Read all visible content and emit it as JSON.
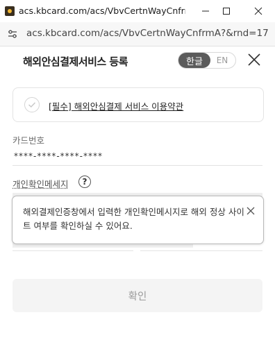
{
  "window": {
    "title": "acs.kbcard.com/acs/VbvCertnWayCnfrm...",
    "url": "acs.kbcard.com/acs/VbvCertnWayCnfrmA?&rnd=17..."
  },
  "header": {
    "title": "해외안심결제서비스 등록",
    "lang_ko": "한글",
    "lang_en": "EN"
  },
  "terms": {
    "label": "[필수] 해외안심결제 서비스 이용약관"
  },
  "card": {
    "label": "카드번호",
    "value": "****-****-****-****"
  },
  "personal_message": {
    "label": "개인확인메세지",
    "help": "?"
  },
  "tooltip": {
    "text": "해외결제인증창에서 입력한 개인확인메시지로 해외 정상 사이트 여부를 확인하실 수 있어요."
  },
  "footer": {
    "confirm_label": "확인"
  },
  "colors": {
    "accent": "#5b5b5b",
    "muted": "#9a9a9a"
  }
}
